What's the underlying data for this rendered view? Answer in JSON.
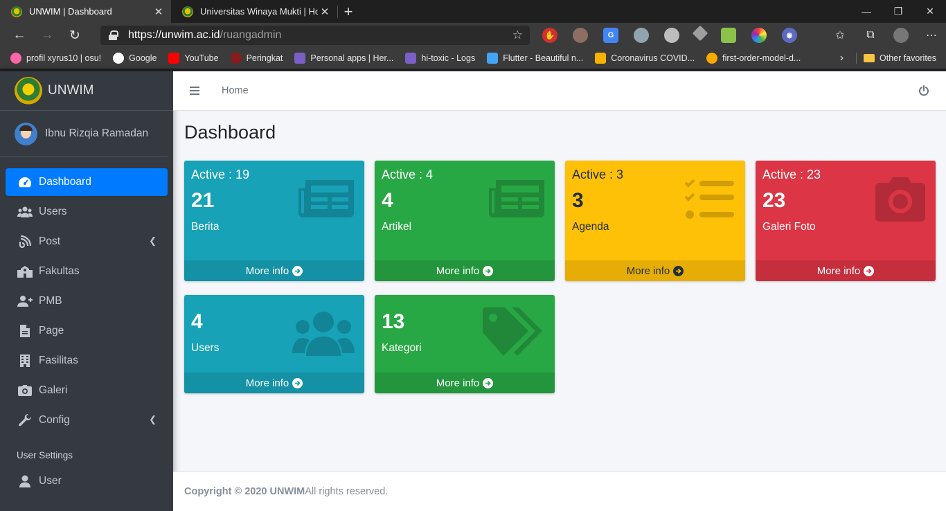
{
  "browser": {
    "tabs": [
      {
        "title": "UNWIM | Dashboard",
        "active": true
      },
      {
        "title": "Universitas Winaya Mukti | Home",
        "active": false
      }
    ],
    "url_host": "https://unwim.ac.id",
    "url_path": "/ruangadmin",
    "bookmarks": [
      {
        "label": "profil xyrus10 | osu!",
        "icon": "osu-icon",
        "color": "#ff66aa"
      },
      {
        "label": "Google",
        "icon": "google-icon",
        "color": "#ffffff"
      },
      {
        "label": "YouTube",
        "icon": "youtube-icon",
        "color": "#ff0000"
      },
      {
        "label": "Peringkat",
        "icon": "peringkat-icon",
        "color": "#8b1a1a"
      },
      {
        "label": "Personal apps | Her...",
        "icon": "heroku-icon",
        "color": "#7b5ec6"
      },
      {
        "label": "hi-toxic - Logs",
        "icon": "heroku-icon",
        "color": "#7b5ec6"
      },
      {
        "label": "Flutter - Beautiful n...",
        "icon": "flutter-icon",
        "color": "#42a5f5"
      },
      {
        "label": "Coronavirus COVID...",
        "icon": "covid-icon",
        "color": "#f4b400"
      },
      {
        "label": "first-order-model-d...",
        "icon": "colab-icon",
        "color": "#f9ab00"
      }
    ],
    "other_favorites": "Other favorites"
  },
  "sidebar": {
    "brand": "UNWIM",
    "user": "Ibnu Rizqia Ramadan",
    "items": [
      {
        "label": "Dashboard",
        "icon": "tachometer-icon",
        "active": true,
        "arrow": false
      },
      {
        "label": "Users",
        "icon": "users-icon",
        "active": false,
        "arrow": false
      },
      {
        "label": "Post",
        "icon": "blog-icon",
        "active": false,
        "arrow": true
      },
      {
        "label": "Fakultas",
        "icon": "school-icon",
        "active": false,
        "arrow": false
      },
      {
        "label": "PMB",
        "icon": "user-plus-icon",
        "active": false,
        "arrow": false
      },
      {
        "label": "Page",
        "icon": "file-icon",
        "active": false,
        "arrow": false
      },
      {
        "label": "Fasilitas",
        "icon": "building-icon",
        "active": false,
        "arrow": false
      },
      {
        "label": "Galeri",
        "icon": "camera-icon",
        "active": false,
        "arrow": false
      },
      {
        "label": "Config",
        "icon": "wrench-icon",
        "active": false,
        "arrow": true
      }
    ],
    "section_header": "User Settings",
    "settings_items": [
      {
        "label": "User",
        "icon": "user-icon"
      }
    ]
  },
  "topnav": {
    "home": "Home"
  },
  "page_title": "Dashboard",
  "boxes": [
    {
      "active": "Active : 19",
      "count": "21",
      "label": "Berita",
      "more": "More info",
      "color": "#17a2b8",
      "icon": "newspaper-icon"
    },
    {
      "active": "Active : 4",
      "count": "4",
      "label": "Artikel",
      "more": "More info",
      "color": "#28a745",
      "icon": "newspaper-icon"
    },
    {
      "active": "Active : 3",
      "count": "3",
      "label": "Agenda",
      "more": "More info",
      "color": "#ffc107",
      "icon": "tasks-icon"
    },
    {
      "active": "Active : 23",
      "count": "23",
      "label": "Galeri Foto",
      "more": "More info",
      "color": "#dc3545",
      "icon": "camera-icon"
    },
    {
      "count": "4",
      "label": "Users",
      "more": "More info",
      "color": "#17a2b8",
      "icon": "users-icon"
    },
    {
      "count": "13",
      "label": "Kategori",
      "more": "More info",
      "color": "#28a745",
      "icon": "tags-icon"
    }
  ],
  "footer": {
    "copyright": "Copyright © 2020 UNWIM",
    "rights": " All rights reserved."
  }
}
